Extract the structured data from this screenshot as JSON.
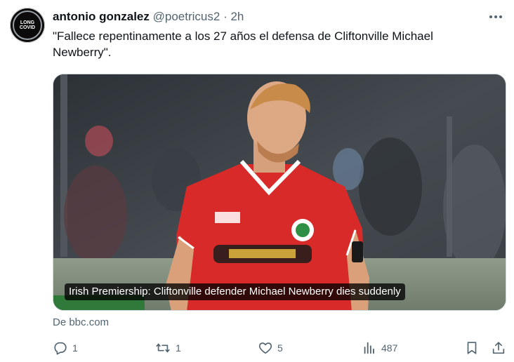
{
  "tweet": {
    "author_name": "antonio gonzalez",
    "handle": "@poetricus2",
    "separator": "·",
    "time": "2h",
    "text": "\"Fallece repentinamente a los 27 años el defensa de Cliftonville Michael Newberry\".",
    "avatar_text": [
      "LONG",
      "COVID"
    ],
    "card": {
      "caption": "Irish Premiership: Cliftonville defender Michael Newberry dies suddenly",
      "source": "De bbc.com"
    },
    "actions": {
      "replies": "1",
      "reposts": "1",
      "likes": "5",
      "views": "487"
    }
  },
  "icons": {
    "more": "more-dots-icon",
    "reply": "reply-icon",
    "repost": "repost-icon",
    "like": "heart-icon",
    "views": "views-chart-icon",
    "bookmark": "bookmark-icon",
    "share": "share-icon"
  },
  "colors": {
    "secondary_text": "#536471",
    "primary_text": "#0f1419",
    "jersey_red": "#d92a2a"
  }
}
